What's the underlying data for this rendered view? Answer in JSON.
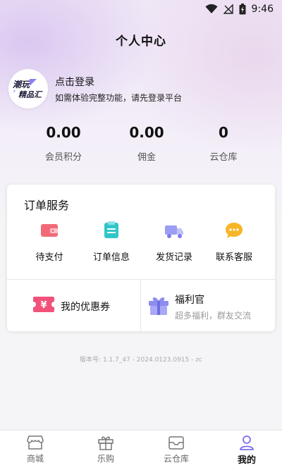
{
  "status_bar": {
    "time": "9:46"
  },
  "page": {
    "title": "个人中心"
  },
  "profile": {
    "login_text": "点击登录",
    "login_hint": "如需体验完整功能，请先登录平台",
    "avatar_logo_text": "潮玩精品汇"
  },
  "stats": [
    {
      "value": "0.00",
      "label": "会员积分"
    },
    {
      "value": "0.00",
      "label": "佣金"
    },
    {
      "value": "0",
      "label": "云仓库"
    }
  ],
  "order_service": {
    "title": "订单服务",
    "items": [
      {
        "label": "待支付",
        "icon": "wallet-icon",
        "color": "#f26a79"
      },
      {
        "label": "订单信息",
        "icon": "document-icon",
        "color": "#30c6c8"
      },
      {
        "label": "发货记录",
        "icon": "truck-icon",
        "color": "#9b9cf2"
      },
      {
        "label": "联系客服",
        "icon": "chat-icon",
        "color": "#f7b627"
      }
    ]
  },
  "coupon": {
    "label": "我的优惠券",
    "icon": "coupon-icon",
    "color": "#f0527a"
  },
  "welfare": {
    "title": "福利官",
    "subtitle": "超多福利，群友交流",
    "icon": "gift-icon",
    "color": "#8d8cf0"
  },
  "version": "版本号: 1.1.7_47 - 2024.0123.0915 - zc",
  "tabbar": {
    "items": [
      {
        "label": "商城",
        "icon": "store-icon",
        "active": false
      },
      {
        "label": "乐购",
        "icon": "gift-box-icon",
        "active": false
      },
      {
        "label": "云仓库",
        "icon": "warehouse-icon",
        "active": false
      },
      {
        "label": "我的",
        "icon": "user-icon",
        "active": true
      }
    ]
  }
}
